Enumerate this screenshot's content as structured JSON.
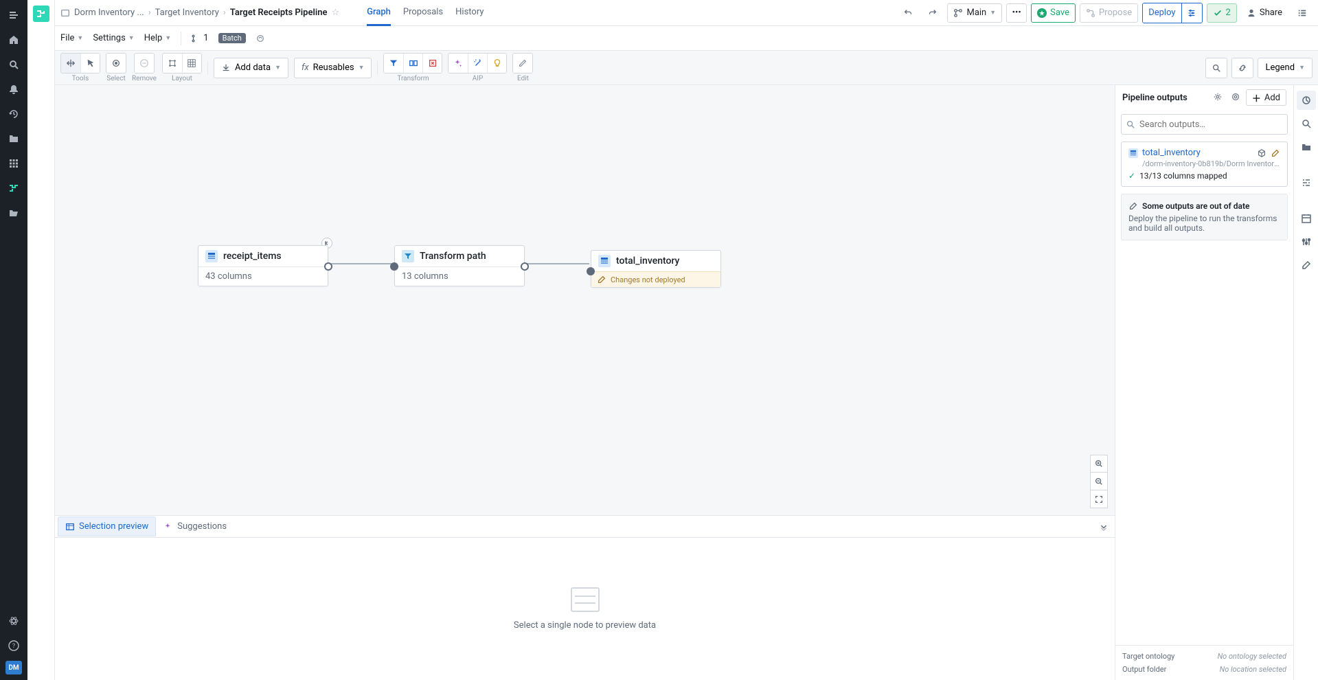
{
  "breadcrumb": {
    "root": "Dorm Inventory ...",
    "mid": "Target Inventory",
    "current": "Target Receipts Pipeline"
  },
  "tabs": {
    "graph": "Graph",
    "proposals": "Proposals",
    "history": "History"
  },
  "header": {
    "main": "Main",
    "save": "Save",
    "propose": "Propose",
    "deploy": "Deploy",
    "check_count": "2",
    "share": "Share"
  },
  "menu": {
    "file": "File",
    "settings": "Settings",
    "help": "Help",
    "branch_count": "1",
    "batch_badge": "Batch"
  },
  "toolbar": {
    "tools": "Tools",
    "select": "Select",
    "remove": "Remove",
    "layout": "Layout",
    "add_data": "Add data",
    "reusables": "Reusables",
    "transform": "Transform",
    "aip": "AIP",
    "edit": "Edit",
    "legend": "Legend"
  },
  "nodes": {
    "receipt": {
      "title": "receipt_items",
      "subtitle": "43 columns"
    },
    "transform": {
      "title": "Transform path",
      "subtitle": "13 columns"
    },
    "output": {
      "title": "total_inventory",
      "warn": "Changes not deployed"
    }
  },
  "bottom": {
    "selection_preview": "Selection preview",
    "suggestions": "Suggestions",
    "empty": "Select a single node to preview data"
  },
  "outputs": {
    "title": "Pipeline outputs",
    "add": "Add",
    "search_placeholder": "Search outputs…",
    "item": {
      "name": "total_inventory",
      "path": "/dorm-inventory-0b819b/Dorm Inventory T…",
      "status": "13/13 columns mapped"
    },
    "warn_title": "Some outputs are out of date",
    "warn_body": "Deploy the pipeline to run the transforms and build all outputs.",
    "target_ontology_label": "Target ontology",
    "target_ontology_value": "No ontology selected",
    "output_folder_label": "Output folder",
    "output_folder_value": "No location selected"
  }
}
